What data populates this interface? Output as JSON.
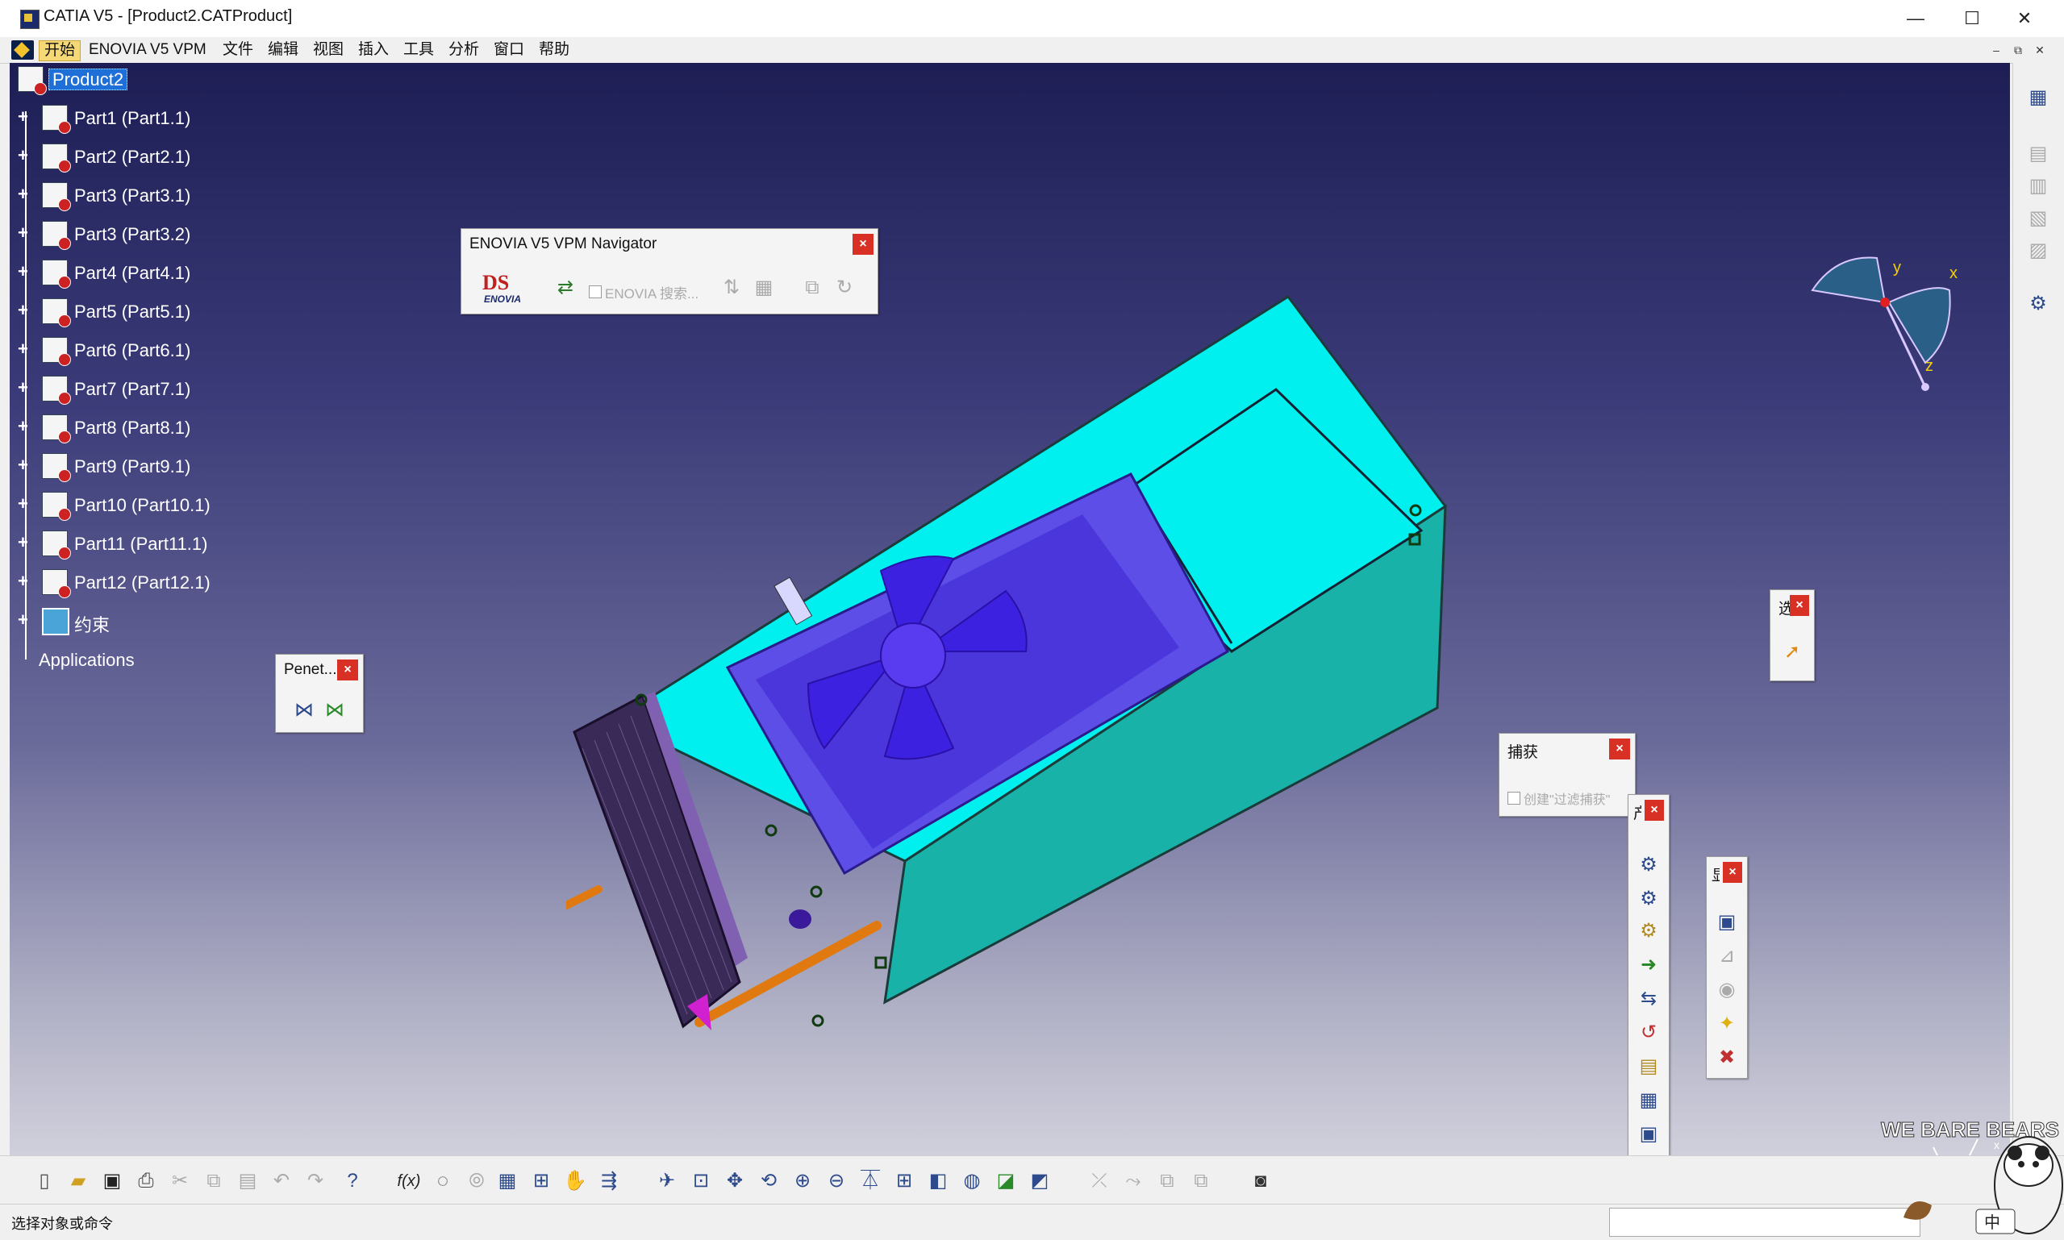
{
  "window": {
    "title": "CATIA V5 - [Product2.CATProduct]",
    "minimize": "—",
    "maximize": "☐",
    "close": "✕"
  },
  "menu": {
    "items": [
      "开始",
      "ENOVIA V5 VPM",
      "文件",
      "编辑",
      "视图",
      "插入",
      "工具",
      "分析",
      "窗口",
      "帮助"
    ],
    "active_index": 0,
    "mdi": {
      "minimize": "–",
      "restore": "⧉",
      "close": "✕"
    }
  },
  "tree": {
    "root": "Product2",
    "items": [
      "Part1 (Part1.1)",
      "Part2 (Part2.1)",
      "Part3 (Part3.1)",
      "Part3 (Part3.2)",
      "Part4 (Part4.1)",
      "Part5 (Part5.1)",
      "Part6 (Part6.1)",
      "Part7 (Part7.1)",
      "Part8 (Part8.1)",
      "Part9 (Part9.1)",
      "Part10 (Part10.1)",
      "Part11 (Part11.1)",
      "Part12 (Part12.1)"
    ],
    "constraints": "约束",
    "applications": "Applications"
  },
  "toolbars": {
    "enovia": {
      "title": "ENOVIA V5 VPM Navigator",
      "search_label": "ENOVIA 搜索...",
      "logo_text": "ENOVIA"
    },
    "penet": {
      "title": "Penet..."
    },
    "select": {
      "title": "选"
    },
    "capture": {
      "title": "捕获",
      "checkbox_label": "创建\"过滤捕获\""
    },
    "product": {
      "title": "产"
    },
    "display": {
      "title": "显"
    }
  },
  "compass": {
    "x": "x",
    "y": "y",
    "z": "z"
  },
  "status": {
    "prompt": "选择对象或命令",
    "input_value": ""
  },
  "watermark": {
    "brand": "WE BARE BEARS",
    "ime": "中"
  },
  "colors": {
    "viewport_top": "#1e1e55",
    "viewport_bottom": "#d0d0dc",
    "part_cyan": "#00f0f0",
    "part_teal": "#19b4aa",
    "fan_blue": "#4a36d6",
    "highlight": "#1e6fd8",
    "close_red": "#d93025"
  }
}
